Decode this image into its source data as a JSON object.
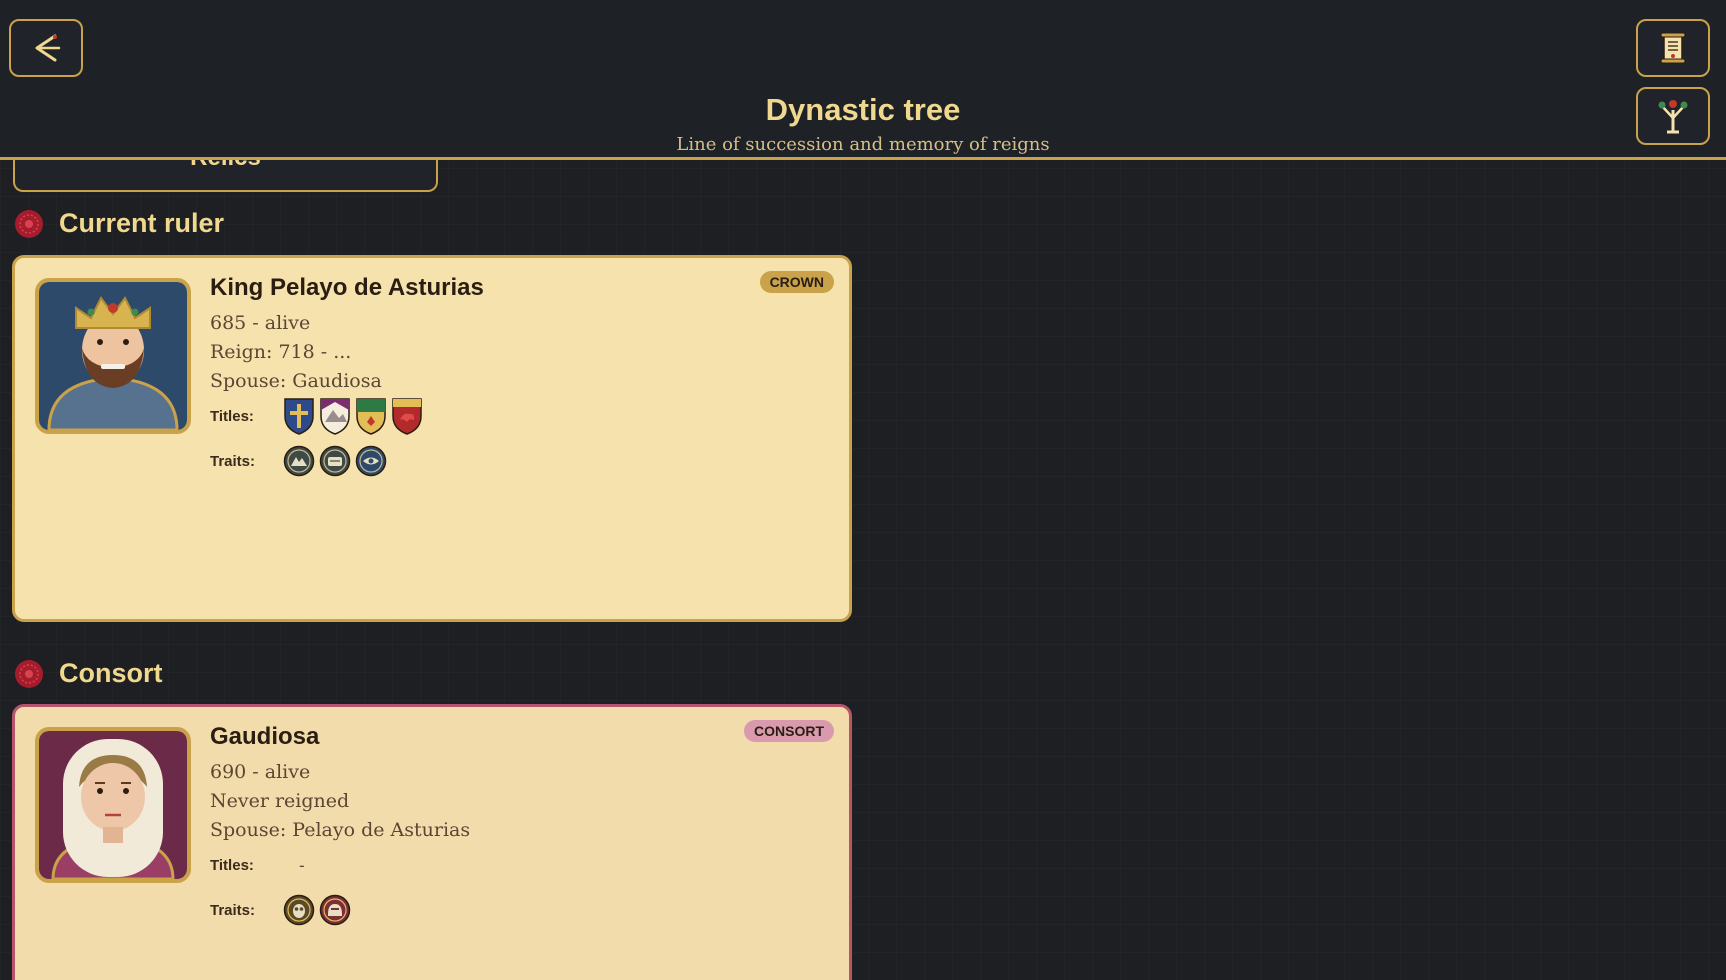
{
  "header": {
    "title": "Dynastic tree",
    "subtitle": "Line of succession and memory of reigns",
    "back_icon": "back-arrow-icon",
    "scroll_icon": "scroll-icon",
    "tree_icon": "tree-icon"
  },
  "tabs": {
    "relics_label": "Relics"
  },
  "sections": {
    "current_ruler": "Current ruler",
    "consort": "Consort"
  },
  "ruler": {
    "name": "King Pelayo de Asturias",
    "badge": "CROWN",
    "lifespan": "685 - alive",
    "reign": "Reign: 718 - ...",
    "spouse": "Spouse: Gaudiosa",
    "titles_label": "Titles:",
    "traits_label": "Traits:",
    "title_shields": [
      "cross-shield-icon",
      "mountain-shield-icon",
      "green-shield-icon",
      "red-dragon-shield-icon"
    ],
    "trait_icons": [
      "mountain-trait-icon",
      "scroll-trait-icon",
      "eye-trait-icon"
    ]
  },
  "consort": {
    "name": "Gaudiosa",
    "badge": "CONSORT",
    "lifespan": "690 - alive",
    "reign": "Never reigned",
    "spouse": "Spouse: Pelayo de Asturias",
    "titles_label": "Titles:",
    "titles_value": "-",
    "traits_label": "Traits:",
    "trait_icons": [
      "owl-trait-icon",
      "helmet-trait-icon"
    ]
  },
  "colors": {
    "gold": "#c9a24a",
    "text_gold": "#f1d88f",
    "card": "#f5e2ac",
    "consort_border": "#b5546a",
    "rose": "#a51d2d"
  }
}
